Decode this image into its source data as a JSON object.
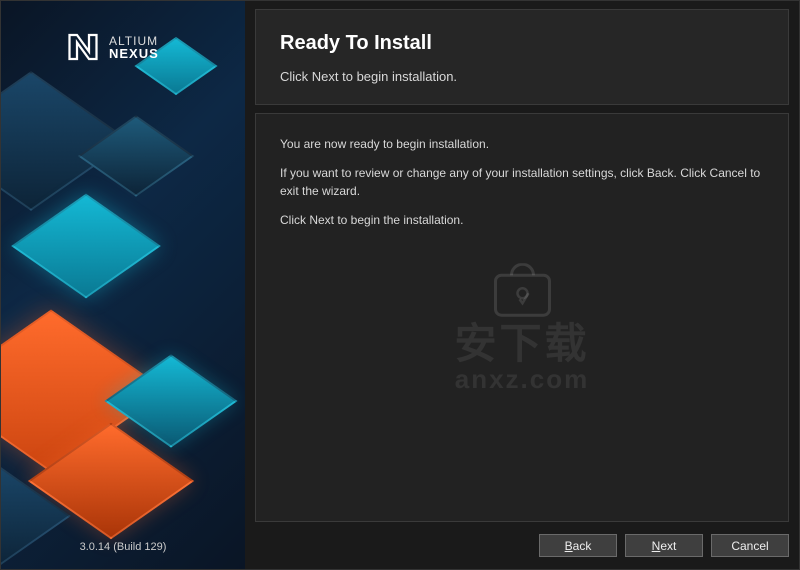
{
  "brand": {
    "line1": "ALTIUM",
    "line2": "NEXUS"
  },
  "version": "3.0.14 (Build 129)",
  "header": {
    "title": "Ready To Install",
    "subtitle": "Click Next to begin installation."
  },
  "content": {
    "p1": "You are now ready to begin installation.",
    "p2": "If you want to review or change any of your installation settings, click Back. Click Cancel to exit the wizard.",
    "p3": "Click Next to begin the installation."
  },
  "buttons": {
    "back_prefix": "B",
    "back_rest": "ack",
    "next_prefix": "N",
    "next_rest": "ext",
    "cancel": "Cancel"
  },
  "watermark": {
    "line1": "安下载",
    "line2": "anxz.com"
  }
}
